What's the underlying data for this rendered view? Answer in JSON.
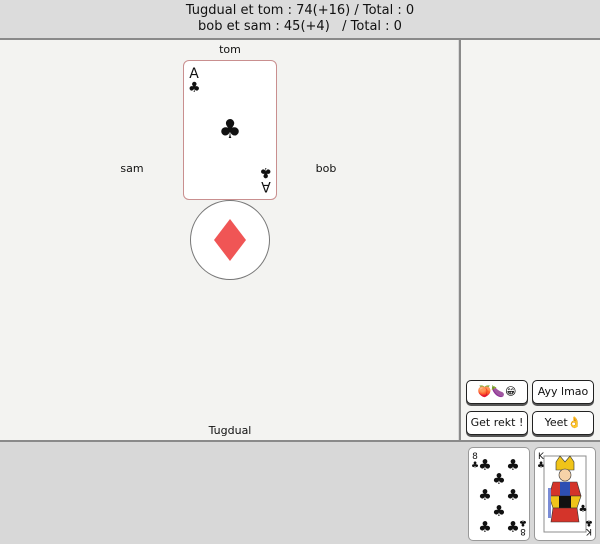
{
  "scores": {
    "line1": "Tugdual et tom : 74(+16) / Total : 0",
    "line2": "bob et sam : 45(+4)   / Total : 0"
  },
  "players": {
    "top": "tom",
    "left": "sam",
    "right": "bob",
    "bottom": "Tugdual"
  },
  "played_card": {
    "rank": "A",
    "suit": "clubs",
    "suit_glyph": "♣"
  },
  "trump": {
    "suit": "diamonds",
    "color": "#f05555"
  },
  "emotes": [
    {
      "label": "🍑🍆😁"
    },
    {
      "label": "Ayy lmao"
    },
    {
      "label": "Get rekt !"
    },
    {
      "label": "Yeet👌"
    }
  ],
  "hand": [
    {
      "rank": "8",
      "suit": "clubs",
      "suit_glyph": "♣"
    },
    {
      "rank": "K",
      "suit": "clubs",
      "suit_glyph": "♣"
    }
  ]
}
